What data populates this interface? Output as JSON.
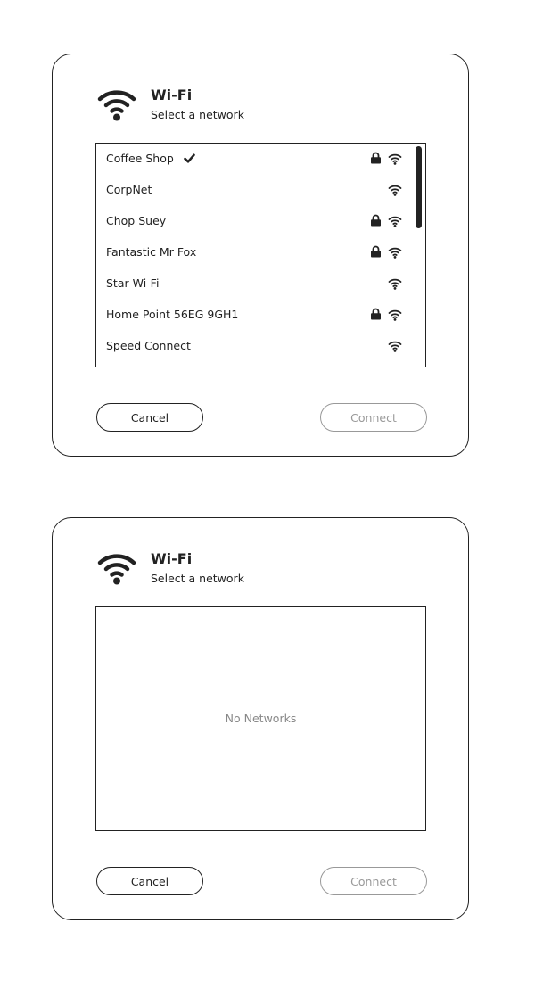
{
  "dialog_with_networks": {
    "title": "Wi-Fi",
    "subtitle": "Select a network",
    "networks": [
      {
        "name": "Coffee Shop",
        "connected": true,
        "secured": true,
        "icon": "wifi-signal-icon"
      },
      {
        "name": "CorpNet",
        "connected": false,
        "secured": false,
        "icon": "wifi-signal-icon"
      },
      {
        "name": "Chop Suey",
        "connected": false,
        "secured": true,
        "icon": "wifi-signal-icon"
      },
      {
        "name": "Fantastic Mr Fox",
        "connected": false,
        "secured": true,
        "icon": "wifi-signal-icon"
      },
      {
        "name": "Star Wi-Fi",
        "connected": false,
        "secured": false,
        "icon": "wifi-signal-icon"
      },
      {
        "name": "Home Point 56EG 9GH1",
        "connected": false,
        "secured": true,
        "icon": "wifi-signal-icon"
      },
      {
        "name": "Speed Connect",
        "connected": false,
        "secured": false,
        "icon": "wifi-signal-icon"
      }
    ],
    "cancel_label": "Cancel",
    "connect_label": "Connect",
    "connect_enabled": false
  },
  "dialog_empty": {
    "title": "Wi-Fi",
    "subtitle": "Select a network",
    "empty_message": "No Networks",
    "cancel_label": "Cancel",
    "connect_label": "Connect",
    "connect_enabled": false
  },
  "icons": {
    "header": "wifi-icon",
    "connected": "checkmark-icon",
    "secured": "lock-icon",
    "signal": "wifi-signal-icon"
  },
  "colors": {
    "foreground": "#222222",
    "disabled": "#999999",
    "placeholder_text": "#888888",
    "background": "#ffffff"
  }
}
